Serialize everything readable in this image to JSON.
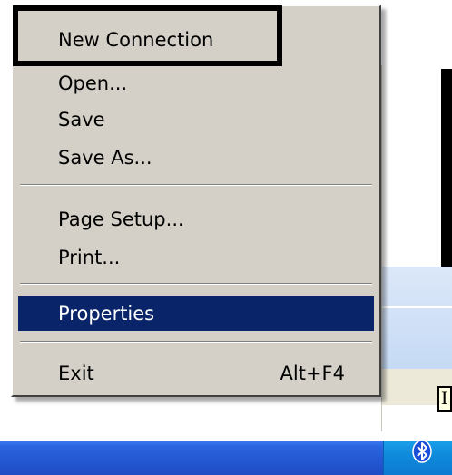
{
  "menu": {
    "items": [
      {
        "label": "New Connection",
        "shortcut": ""
      },
      {
        "label": "Open...",
        "shortcut": ""
      },
      {
        "label": "Save",
        "shortcut": ""
      },
      {
        "label": "Save As...",
        "shortcut": ""
      },
      {
        "label": "Page Setup...",
        "shortcut": ""
      },
      {
        "label": "Print...",
        "shortcut": ""
      },
      {
        "label": "Properties",
        "shortcut": ""
      },
      {
        "label": "Exit",
        "shortcut": "Alt+F4"
      }
    ],
    "highlighted_item": "Properties",
    "colors": {
      "menu_background": "#d4d0c8",
      "highlight_background": "#0a246a",
      "highlight_text": "#ffffff"
    }
  },
  "background": {
    "partial_glyph": "I"
  },
  "taskbar": {
    "tray_icon": "bluetooth-icon",
    "color": "#2457d2"
  },
  "annotation": {
    "frame_target": "New Connection",
    "frame_color": "#000000"
  }
}
